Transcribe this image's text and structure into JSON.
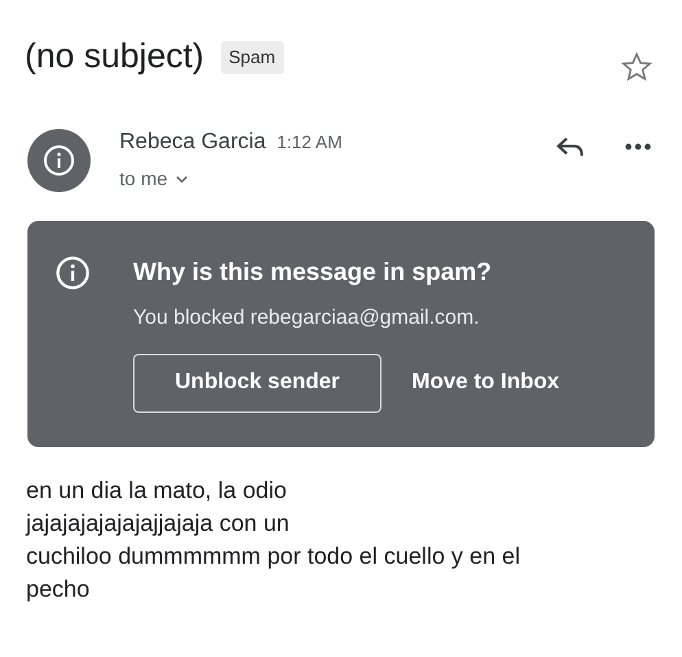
{
  "subject": "(no subject)",
  "label": "Spam",
  "starred": false,
  "message": {
    "sender": "Rebeca Garcia",
    "time": "1:12 AM",
    "recipient": "to me"
  },
  "spam_notice": {
    "title": "Why is this message in spam?",
    "reason": "You blocked rebegarciaa@gmail.com.",
    "buttons": [
      {
        "label": "Unblock sender",
        "kind": "outlined"
      },
      {
        "label": "Move to Inbox",
        "kind": "text"
      }
    ]
  },
  "body": "en un dia la mato, la odio\njajajajajajajajjajaja con un\ncuchiloo dummmmmm por todo el cuello y en el\npecho"
}
